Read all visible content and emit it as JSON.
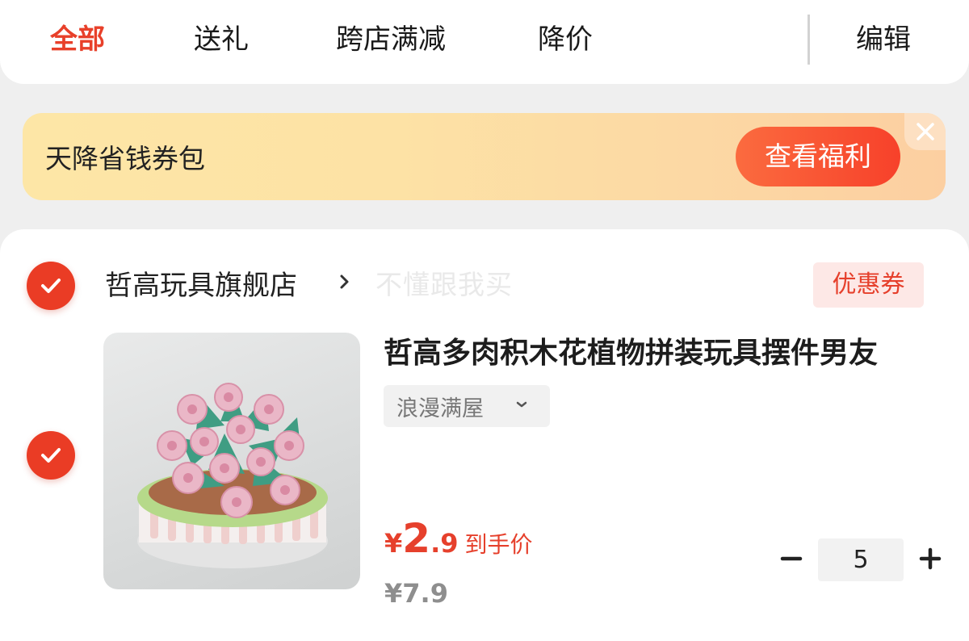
{
  "tabs": [
    {
      "label": "全部",
      "active": true
    },
    {
      "label": "送礼",
      "active": false
    },
    {
      "label": "跨店满减",
      "active": false
    },
    {
      "label": "降价",
      "active": false
    }
  ],
  "edit_label": "编辑",
  "banner": {
    "title": "天降省钱券包",
    "button_label": "查看福利"
  },
  "store": {
    "name": "哲高玩具旗舰店",
    "slogan": "不懂跟我买",
    "coupon_label": "优惠券",
    "checked": true
  },
  "product": {
    "checked": true,
    "title": "哲高多肉积木花植物拼装玩具摆件男友",
    "sku": "浪漫满屋",
    "price": {
      "currency": "¥",
      "integer": "2",
      "decimal": ".9",
      "label": "到手价"
    },
    "original_price": "¥7.9",
    "quantity": "5"
  },
  "colors": {
    "accent": "#e8402a",
    "banner_bg": "#fde6a6",
    "page_bg": "#efefef"
  }
}
